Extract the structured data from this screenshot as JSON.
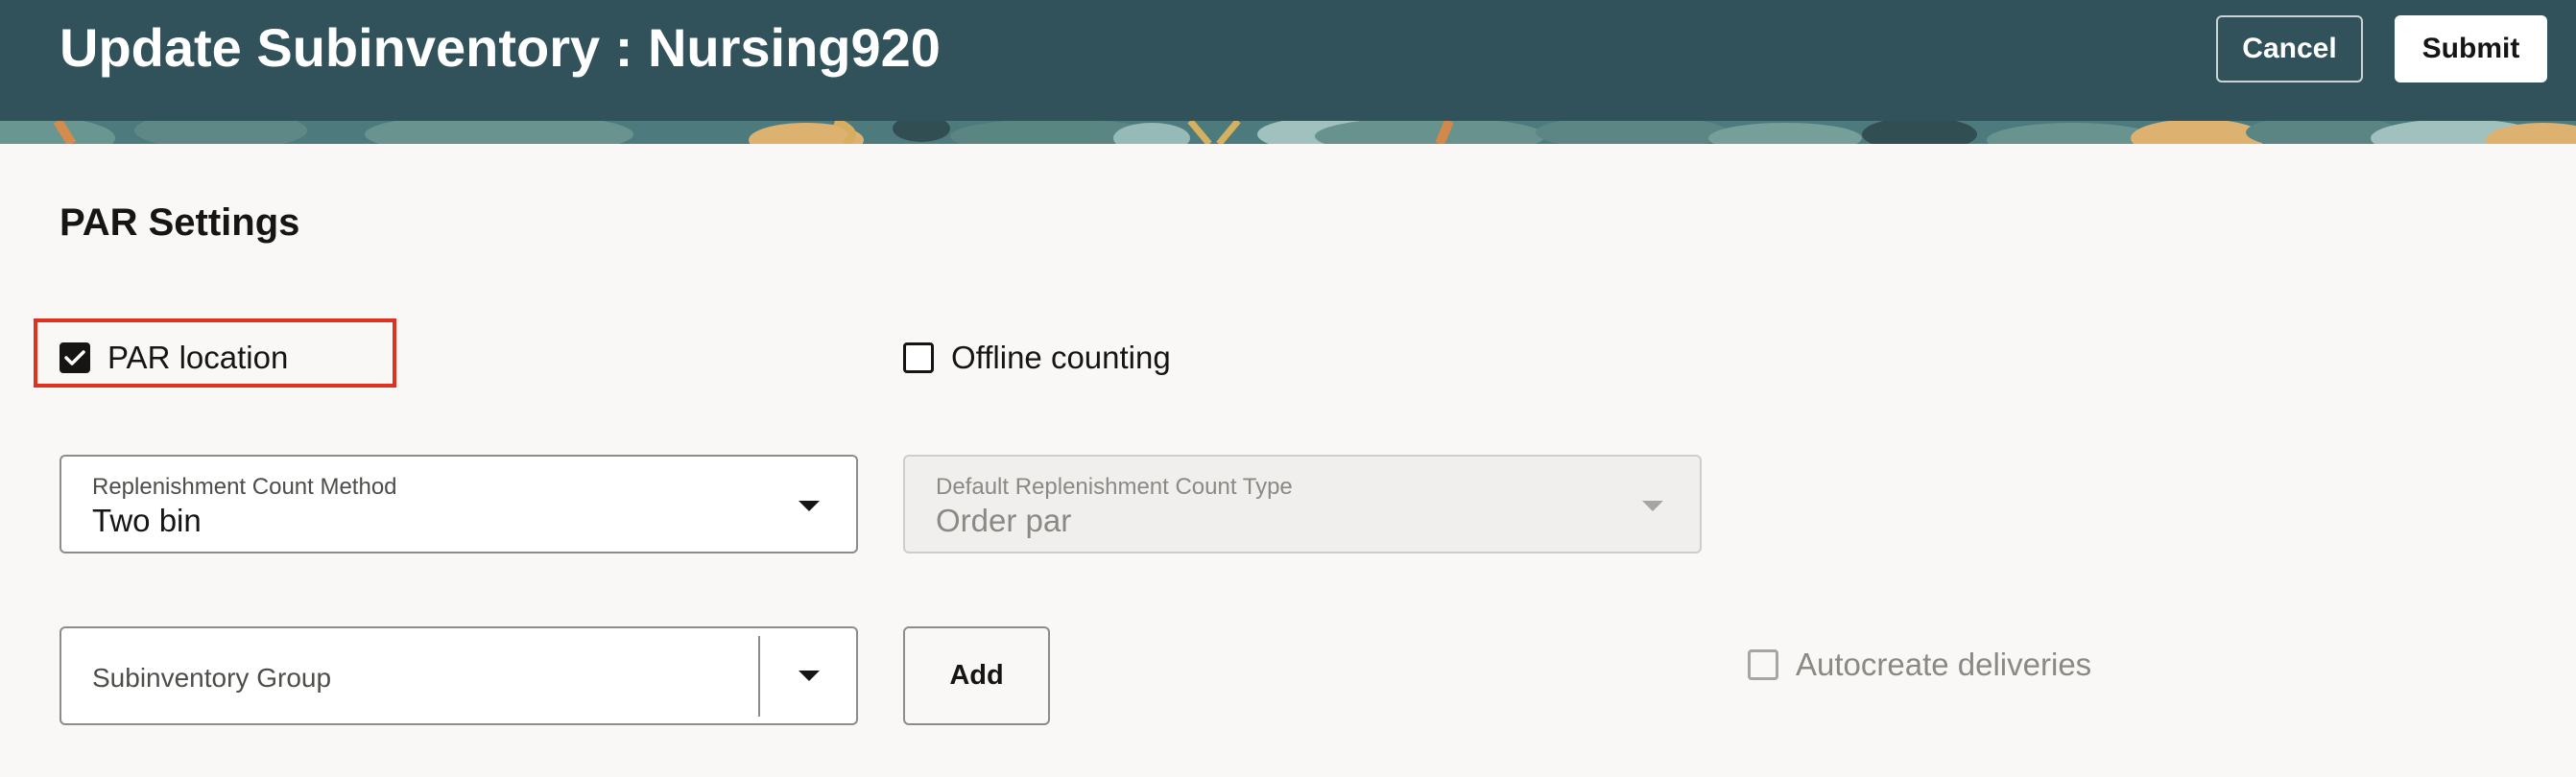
{
  "header": {
    "title": "Update Subinventory : Nursing920",
    "cancel_label": "Cancel",
    "submit_label": "Submit",
    "background_color": "#31525b"
  },
  "par_settings": {
    "section_title": "PAR Settings",
    "par_location": {
      "label": "PAR location",
      "checked": true,
      "highlighted": true
    },
    "offline_counting": {
      "label": "Offline counting",
      "checked": false
    },
    "replenishment_count_method": {
      "label": "Replenishment Count Method",
      "value": "Two bin"
    },
    "default_replenishment_count_type": {
      "label": "Default Replenishment Count Type",
      "value": "Order par",
      "disabled": true
    },
    "subinventory_group": {
      "placeholder": "Subinventory Group",
      "value": ""
    },
    "add_label": "Add",
    "autocreate_deliveries": {
      "label": "Autocreate deliveries",
      "checked": false,
      "disabled": true
    }
  },
  "colors": {
    "page_background": "#f9f8f6",
    "highlight_border": "#e0301e"
  }
}
